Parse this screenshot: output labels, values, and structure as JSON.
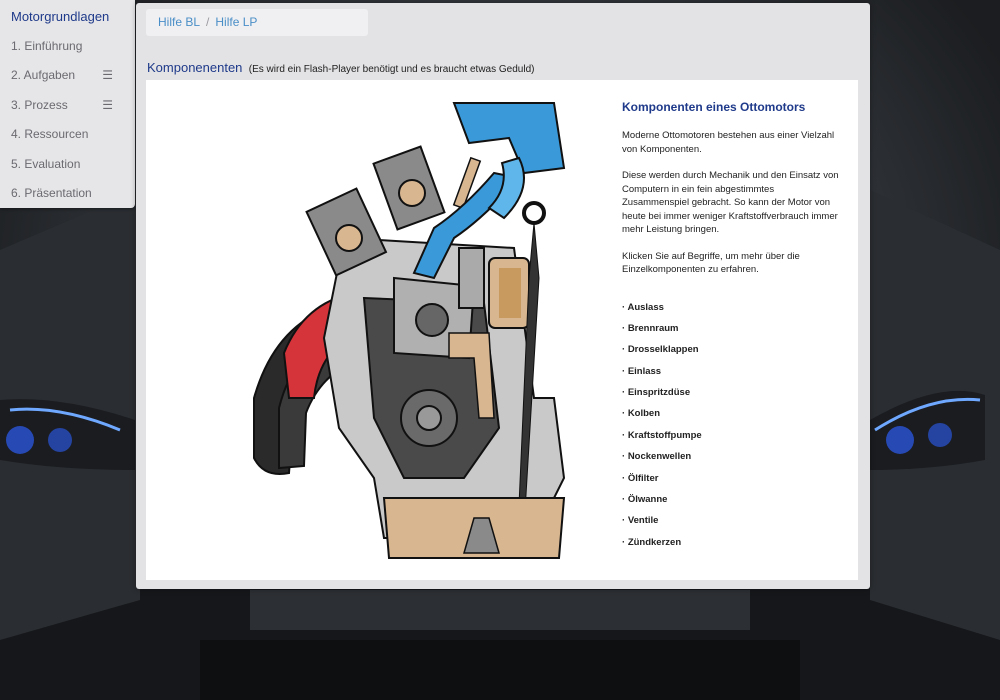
{
  "sidebar": {
    "title": "Motorgrundlagen",
    "items": [
      {
        "label": "1. Einführung",
        "has_menu": false
      },
      {
        "label": "2. Aufgaben",
        "has_menu": true
      },
      {
        "label": "3. Prozess",
        "has_menu": true
      },
      {
        "label": "4. Ressourcen",
        "has_menu": false
      },
      {
        "label": "5. Evaluation",
        "has_menu": false
      },
      {
        "label": "6. Präsentation",
        "has_menu": false
      }
    ],
    "menu_icon": "☰"
  },
  "breadcrumb": {
    "link1": "Hilfe BL",
    "separator": "/",
    "link2": "Hilfe LP"
  },
  "section": {
    "title": "Komponenenten",
    "note": "(Es wird ein Flash-Player benötigt und es braucht etwas Geduld)"
  },
  "info": {
    "heading": "Komponenten eines Ottomotors",
    "paragraphs": [
      "Moderne Ottomotoren bestehen aus einer Vielzahl von Komponenten.",
      "Diese werden durch Mechanik und den Einsatz von Computern in ein fein abgestimmtes Zusammenspiel gebracht. So kann der Motor von heute bei immer weniger Kraftstoffverbrauch immer mehr Leistung bringen.",
      "Klicken Sie auf Begriffe, um mehr über die Einzelkomponenten zu erfahren."
    ],
    "components": [
      "Auslass",
      "Brennraum",
      "Drosselklappen",
      "Einlass",
      "Einspritzdüse",
      "Kolben",
      "Kraftstoffpumpe",
      "Nockenwellen",
      "Ölfilter",
      "Ölwanne",
      "Ventile",
      "Zündkerzen"
    ]
  },
  "colors": {
    "accent": "#1f3a8a",
    "link": "#4a8ec7",
    "intake_blue": "#3a9ad9",
    "exhaust_red": "#d4343a"
  }
}
